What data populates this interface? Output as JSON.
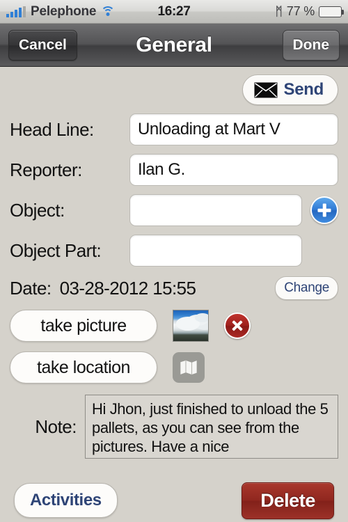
{
  "status_bar": {
    "carrier": "Pelephone",
    "time": "16:27",
    "battery_percent": "77 %",
    "battery_level": 77,
    "signal_bars_filled": 4,
    "signal_bars_total": 5,
    "wifi_icon": "wifi-icon",
    "bluetooth_icon": "bluetooth-icon",
    "bluetooth_glyph": "ᛗ"
  },
  "nav_bar": {
    "cancel_label": "Cancel",
    "title": "General",
    "done_label": "Done"
  },
  "send": {
    "label": "Send",
    "icon": "envelope-icon"
  },
  "form": {
    "head_line": {
      "label": "Head Line:",
      "value": "Unloading at Mart V",
      "placeholder": ""
    },
    "reporter": {
      "label": "Reporter:",
      "value": "Ilan G.",
      "placeholder": ""
    },
    "object": {
      "label": "Object:",
      "value": "",
      "placeholder": ""
    },
    "object_part": {
      "label": "Object Part:",
      "value": "",
      "placeholder": ""
    },
    "add_object_icon": "plus-icon"
  },
  "date": {
    "label": "Date:",
    "value": "03-28-2012 15:55",
    "change_label": "Change"
  },
  "picture": {
    "button_label": "take picture",
    "thumbnail_alt": "sky-photo-thumbnail",
    "delete_icon": "delete-x-icon"
  },
  "location": {
    "button_label": "take location",
    "map_icon": "map-icon"
  },
  "note": {
    "label": "Note:",
    "value": "Hi Jhon, just finished to unload the 5 pallets, as you can see from the pictures. Have a nice",
    "placeholder": ""
  },
  "bottom_bar": {
    "activities_label": "Activities",
    "delete_label": "Delete"
  },
  "colors": {
    "background": "#d5d2cb",
    "accent_blue": "#2e4476",
    "plus_blue": "#2f79d4",
    "delete_red": "#90271f",
    "badge_red": "#9e1f1c",
    "battery_green": "#5cba16",
    "signal_blue": "#2f7fd6"
  }
}
